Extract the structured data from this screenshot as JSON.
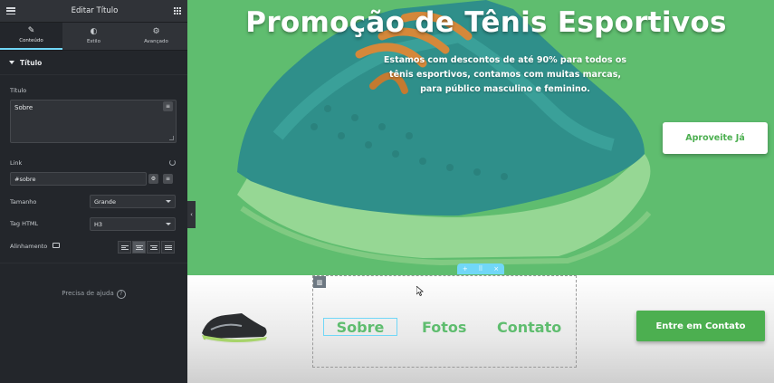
{
  "editor": {
    "title": "Editar Título",
    "tabs": [
      {
        "label": "Conteúdo",
        "icon": "pencil-icon"
      },
      {
        "label": "Estilo",
        "icon": "contrast-icon"
      },
      {
        "label": "Avançado",
        "icon": "gear-icon"
      }
    ],
    "section_title": "Título",
    "fields": {
      "title_label": "Título",
      "title_value": "Sobre",
      "link_label": "Link",
      "link_value": "#sobre",
      "size_label": "Tamanho",
      "size_value": "Grande",
      "tag_label": "Tag HTML",
      "tag_value": "H3",
      "align_label": "Alinhamento"
    },
    "help_text": "Precisa de ajuda",
    "help_icon": "?"
  },
  "hero": {
    "title": "Promoção de Tênis Esportivos",
    "subtitle": "Estamos com descontos de até 90% para todos os tênis esportivos, contamos com muitas marcas, para público masculino e feminino.",
    "cta_label": "Aproveite Já",
    "background_color": "#5fbd6f"
  },
  "navbar": {
    "menu": [
      "Sobre",
      "Fotos",
      "Contato"
    ],
    "cta_label": "Entre em Contato",
    "accent_color": "#4caf50"
  },
  "toolbar": {
    "add": "+",
    "move": "⠿",
    "close": "×"
  }
}
